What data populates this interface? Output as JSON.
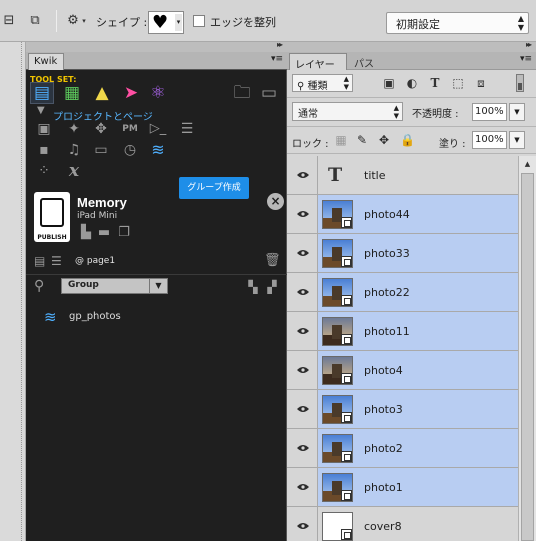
{
  "options_bar": {
    "shape_label": "シェイプ :",
    "align_edges_label": "エッジを整列",
    "align_edges_checked": false,
    "preset_value": "初期設定",
    "icons": [
      "path-operations-icon",
      "path-arrangement-icon",
      "gear-icon",
      "heart-shape-icon"
    ]
  },
  "kwik": {
    "tab_label": "Kwik",
    "toolset_label": "TOOL SET:",
    "project_label": "プロジェクトとページ",
    "tooltip": "グループ作成",
    "device_title": "Memory",
    "device_subtitle": "iPad Mini",
    "publish_label": "PUBLISH",
    "page_label": "@ page1",
    "group_select_value": "Group",
    "tree_item_label": "gp_photos"
  },
  "layers": {
    "tab_layers": "レイヤー",
    "tab_paths": "パス",
    "filter_value": "種類",
    "blend_mode": "通常",
    "opacity_label": "不透明度 :",
    "opacity_value": "100%",
    "lock_label": "ロック :",
    "fill_label": "塗り :",
    "fill_value": "100%",
    "items": [
      {
        "name": "title",
        "type": "text",
        "selected": false
      },
      {
        "name": "photo44",
        "type": "smart",
        "selected": true
      },
      {
        "name": "photo33",
        "type": "smart",
        "selected": true
      },
      {
        "name": "photo22",
        "type": "smart",
        "selected": true
      },
      {
        "name": "photo11",
        "type": "smart",
        "selected": true
      },
      {
        "name": "photo4",
        "type": "smart",
        "selected": true
      },
      {
        "name": "photo3",
        "type": "smart",
        "selected": true
      },
      {
        "name": "photo2",
        "type": "smart",
        "selected": true
      },
      {
        "name": "photo1",
        "type": "smart",
        "selected": true
      },
      {
        "name": "cover8",
        "type": "smart",
        "selected": false
      }
    ]
  },
  "colors": {
    "selection": "#b8cdf2",
    "kwik_bg": "#1f1f1f",
    "kwik_accent": "#58b7ff",
    "tooltip_bg": "#1e8ee8",
    "toolset_label": "#f0c400"
  }
}
